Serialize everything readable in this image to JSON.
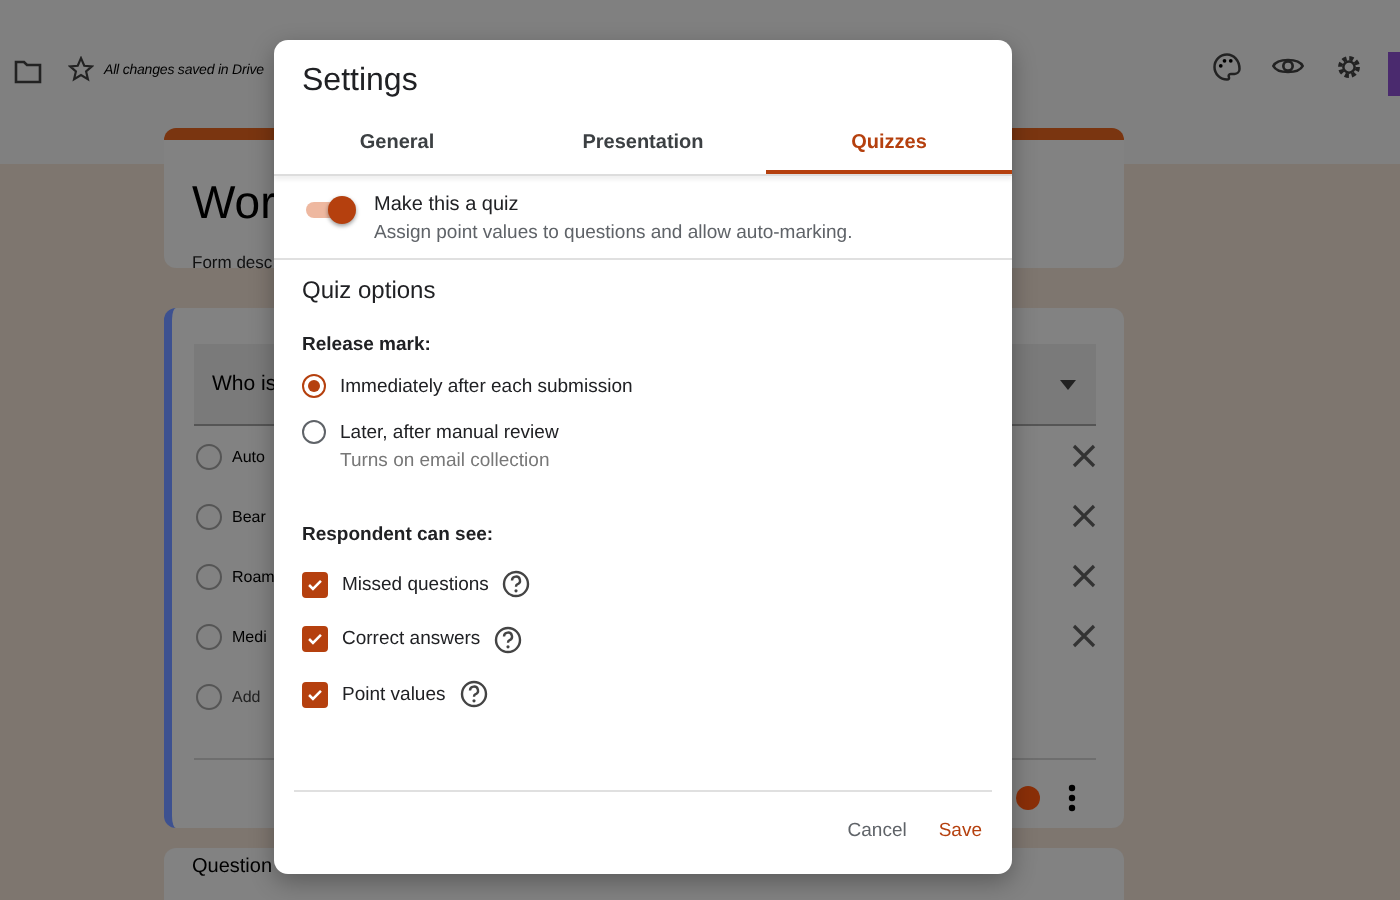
{
  "app_bar": {
    "status": "All changes saved in Drive"
  },
  "form": {
    "title": "Wor",
    "description": "Form desc"
  },
  "question": {
    "title": "Who is",
    "options": [
      {
        "label": "Auto",
        "selected": false
      },
      {
        "label": "Bear",
        "selected": false
      },
      {
        "label": "Roam",
        "selected": false
      },
      {
        "label": "Medi",
        "selected": false
      }
    ],
    "add_option": "Add"
  },
  "next_question": {
    "title": "Question"
  },
  "dialog": {
    "title": "Settings",
    "tabs": [
      {
        "label": "General",
        "selected": false
      },
      {
        "label": "Presentation",
        "selected": false
      },
      {
        "label": "Quizzes",
        "selected": true
      }
    ],
    "quiz_toggle": {
      "label": "Make this a quiz",
      "description": "Assign point values to questions and allow auto-marking.",
      "on": true
    },
    "section_title": "Quiz options",
    "release": {
      "heading": "Release mark:",
      "options": [
        {
          "label": "Immediately after each submission",
          "selected": true
        },
        {
          "label": "Later, after manual review",
          "note": "Turns on email collection",
          "selected": false
        }
      ]
    },
    "respondent": {
      "heading": "Respondent can see:",
      "options": [
        {
          "label": "Missed questions",
          "checked": true
        },
        {
          "label": "Correct answers",
          "checked": true
        },
        {
          "label": "Point values",
          "checked": true
        }
      ]
    },
    "buttons": {
      "cancel": "Cancel",
      "save": "Save"
    }
  }
}
